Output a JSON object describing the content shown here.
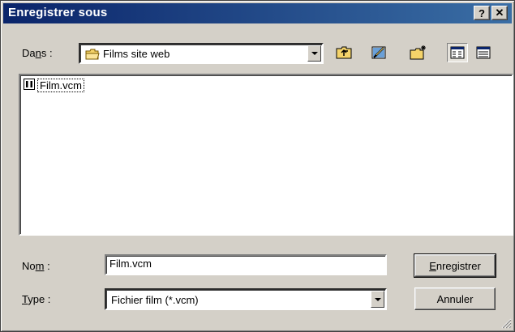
{
  "window": {
    "title": "Enregistrer sous"
  },
  "titlebar": {
    "help_label": "?",
    "close_label": "✕"
  },
  "location": {
    "label_pre": "Da",
    "label_accel": "n",
    "label_post": "s :",
    "current_folder": "Films site web"
  },
  "files": [
    {
      "name": "Film.vcm",
      "icon": "vcm-file-icon"
    }
  ],
  "name_field": {
    "label_pre": "No",
    "label_accel": "m",
    "label_post": " :",
    "value": "Film.vcm"
  },
  "type_field": {
    "label_pre": "",
    "label_accel": "T",
    "label_post": "ype :",
    "value": "Fichier film (*.vcm)"
  },
  "buttons": {
    "save_accel": "E",
    "save_rest": "nregistrer",
    "cancel": "Annuler"
  },
  "colors": {
    "titlebar_start": "#0a246a",
    "titlebar_end": "#3a6ea5",
    "face": "#d4d0c8"
  }
}
